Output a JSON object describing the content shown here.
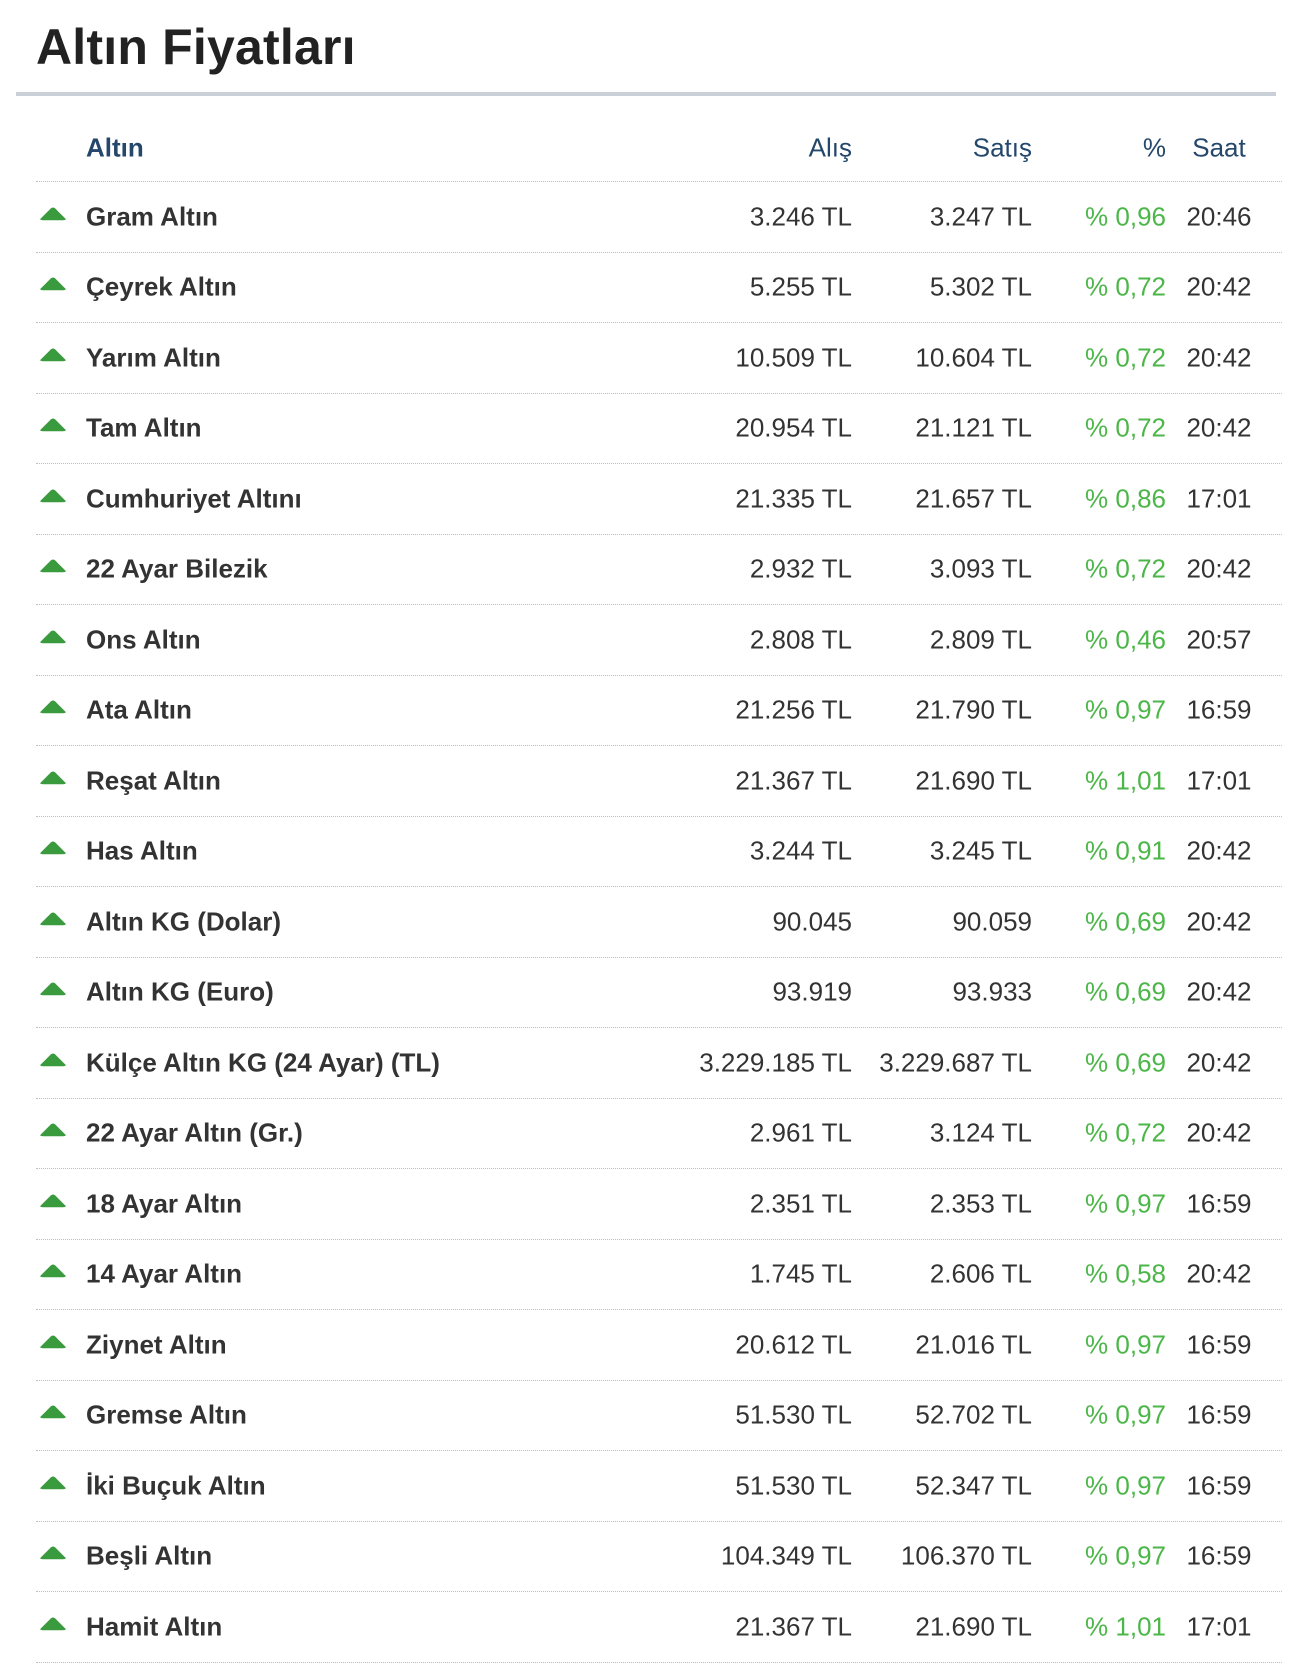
{
  "title": "Altın Fiyatları",
  "colors": {
    "up": "#3a9a3e",
    "percent": "#4cb648",
    "header": "#24476b"
  },
  "table": {
    "headers": {
      "name": "Altın",
      "buy": "Alış",
      "sell": "Satış",
      "pct": "%",
      "time": "Saat"
    },
    "rows": [
      {
        "name": "Gram Altın",
        "buy": "3.246 TL",
        "sell": "3.247 TL",
        "pct": "% 0,96",
        "time": "20:46",
        "icon": "arrow-up-icon"
      },
      {
        "name": "Çeyrek Altın",
        "buy": "5.255 TL",
        "sell": "5.302 TL",
        "pct": "% 0,72",
        "time": "20:42",
        "icon": "arrow-up-icon"
      },
      {
        "name": "Yarım Altın",
        "buy": "10.509 TL",
        "sell": "10.604 TL",
        "pct": "% 0,72",
        "time": "20:42",
        "icon": "arrow-up-icon"
      },
      {
        "name": "Tam Altın",
        "buy": "20.954 TL",
        "sell": "21.121 TL",
        "pct": "% 0,72",
        "time": "20:42",
        "icon": "arrow-up-icon"
      },
      {
        "name": "Cumhuriyet Altını",
        "buy": "21.335 TL",
        "sell": "21.657 TL",
        "pct": "% 0,86",
        "time": "17:01",
        "icon": "arrow-up-icon"
      },
      {
        "name": "22 Ayar Bilezik",
        "buy": "2.932 TL",
        "sell": "3.093 TL",
        "pct": "% 0,72",
        "time": "20:42",
        "icon": "arrow-up-icon"
      },
      {
        "name": "Ons Altın",
        "buy": "2.808 TL",
        "sell": "2.809 TL",
        "pct": "% 0,46",
        "time": "20:57",
        "icon": "arrow-up-icon"
      },
      {
        "name": "Ata Altın",
        "buy": "21.256 TL",
        "sell": "21.790 TL",
        "pct": "% 0,97",
        "time": "16:59",
        "icon": "arrow-up-icon"
      },
      {
        "name": "Reşat Altın",
        "buy": "21.367 TL",
        "sell": "21.690 TL",
        "pct": "% 1,01",
        "time": "17:01",
        "icon": "arrow-up-icon"
      },
      {
        "name": "Has Altın",
        "buy": "3.244 TL",
        "sell": "3.245 TL",
        "pct": "% 0,91",
        "time": "20:42",
        "icon": "arrow-up-icon"
      },
      {
        "name": "Altın KG (Dolar)",
        "buy": "90.045",
        "sell": "90.059",
        "pct": "% 0,69",
        "time": "20:42",
        "icon": "arrow-up-icon"
      },
      {
        "name": "Altın KG (Euro)",
        "buy": "93.919",
        "sell": "93.933",
        "pct": "% 0,69",
        "time": "20:42",
        "icon": "arrow-up-icon"
      },
      {
        "name": "Külçe Altın KG (24 Ayar) (TL)",
        "buy": "3.229.185 TL",
        "sell": "3.229.687 TL",
        "pct": "% 0,69",
        "time": "20:42",
        "icon": "arrow-up-icon"
      },
      {
        "name": "22 Ayar Altın (Gr.)",
        "buy": "2.961 TL",
        "sell": "3.124 TL",
        "pct": "% 0,72",
        "time": "20:42",
        "icon": "arrow-up-icon"
      },
      {
        "name": "18 Ayar Altın",
        "buy": "2.351 TL",
        "sell": "2.353 TL",
        "pct": "% 0,97",
        "time": "16:59",
        "icon": "arrow-up-icon"
      },
      {
        "name": "14 Ayar Altın",
        "buy": "1.745 TL",
        "sell": "2.606 TL",
        "pct": "% 0,58",
        "time": "20:42",
        "icon": "arrow-up-icon"
      },
      {
        "name": "Ziynet Altın",
        "buy": "20.612 TL",
        "sell": "21.016 TL",
        "pct": "% 0,97",
        "time": "16:59",
        "icon": "arrow-up-icon"
      },
      {
        "name": "Gremse Altın",
        "buy": "51.530 TL",
        "sell": "52.702 TL",
        "pct": "% 0,97",
        "time": "16:59",
        "icon": "arrow-up-icon"
      },
      {
        "name": "İki Buçuk Altın",
        "buy": "51.530 TL",
        "sell": "52.347 TL",
        "pct": "% 0,97",
        "time": "16:59",
        "icon": "arrow-up-icon"
      },
      {
        "name": "Beşli Altın",
        "buy": "104.349 TL",
        "sell": "106.370 TL",
        "pct": "% 0,97",
        "time": "16:59",
        "icon": "arrow-up-icon"
      },
      {
        "name": "Hamit Altın",
        "buy": "21.367 TL",
        "sell": "21.690 TL",
        "pct": "% 1,01",
        "time": "17:01",
        "icon": "arrow-up-icon"
      }
    ]
  }
}
